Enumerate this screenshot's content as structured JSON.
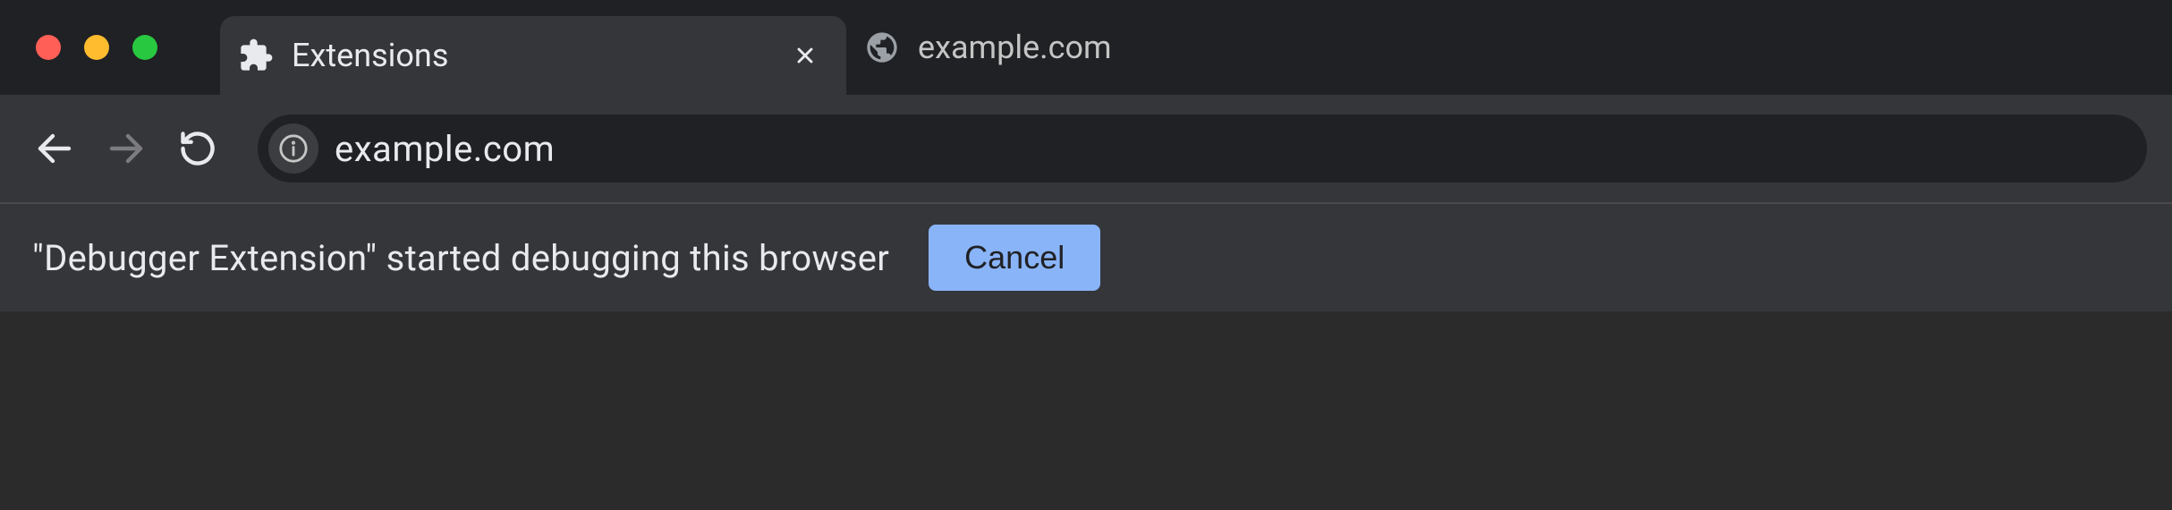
{
  "tabs": [
    {
      "title": "Extensions",
      "active": true,
      "icon": "extension"
    },
    {
      "title": "example.com",
      "active": false,
      "icon": "globe"
    }
  ],
  "navigation": {
    "back_enabled": true,
    "forward_enabled": false
  },
  "omnibox": {
    "url": "example.com"
  },
  "infobar": {
    "message": "\"Debugger Extension\" started debugging this browser",
    "cancel_label": "Cancel"
  }
}
